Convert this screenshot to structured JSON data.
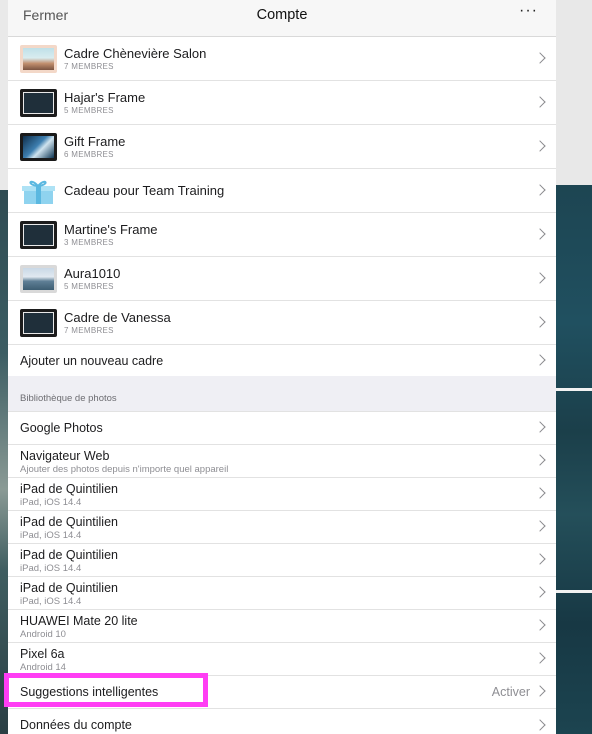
{
  "nav": {
    "close_label": "Fermer",
    "title": "Compte",
    "more_label": "···"
  },
  "frames": [
    {
      "name": "Cadre Chènevière Salon",
      "members": "7 MEMBRES",
      "thumb": "salon"
    },
    {
      "name": "Hajar's Frame",
      "members": "5 MEMBRES",
      "thumb": "dark"
    },
    {
      "name": "Gift Frame",
      "members": "6 MEMBRES",
      "thumb": "photo"
    },
    {
      "name": "Cadeau pour Team Training",
      "members": "",
      "thumb": "gift"
    },
    {
      "name": "Martine's Frame",
      "members": "3 MEMBRES",
      "thumb": "dark"
    },
    {
      "name": "Aura1010",
      "members": "5 MEMBRES",
      "thumb": "sea"
    },
    {
      "name": "Cadre de Vanessa",
      "members": "7 MEMBRES",
      "thumb": "dark"
    }
  ],
  "add_frame_label": "Ajouter un nouveau cadre",
  "photo_library": {
    "header": "Bibliothèque de photos",
    "items": [
      {
        "title": "Google Photos",
        "sub": ""
      },
      {
        "title": "Navigateur Web",
        "sub": "Ajouter des photos depuis n'importe quel appareil"
      },
      {
        "title": "iPad de Quintilien",
        "sub": "iPad, iOS 14.4"
      },
      {
        "title": "iPad de Quintilien",
        "sub": "iPad, iOS 14.4"
      },
      {
        "title": "iPad de Quintilien",
        "sub": "iPad, iOS 14.4"
      },
      {
        "title": "iPad de Quintilien",
        "sub": "iPad, iOS 14.4"
      },
      {
        "title": "HUAWEI Mate 20 lite",
        "sub": "Android 10"
      },
      {
        "title": "Pixel 6a",
        "sub": "Android 14"
      }
    ]
  },
  "smart_suggestions": {
    "label": "Suggestions intelligentes",
    "action": "Activer"
  },
  "account_data_label": "Données du compte",
  "colors": {
    "highlight": "#ff3df4",
    "frame_border": "#d9d9d9"
  },
  "icons": {
    "chevron": "chevron-right-icon",
    "more": "ellipsis-icon"
  }
}
